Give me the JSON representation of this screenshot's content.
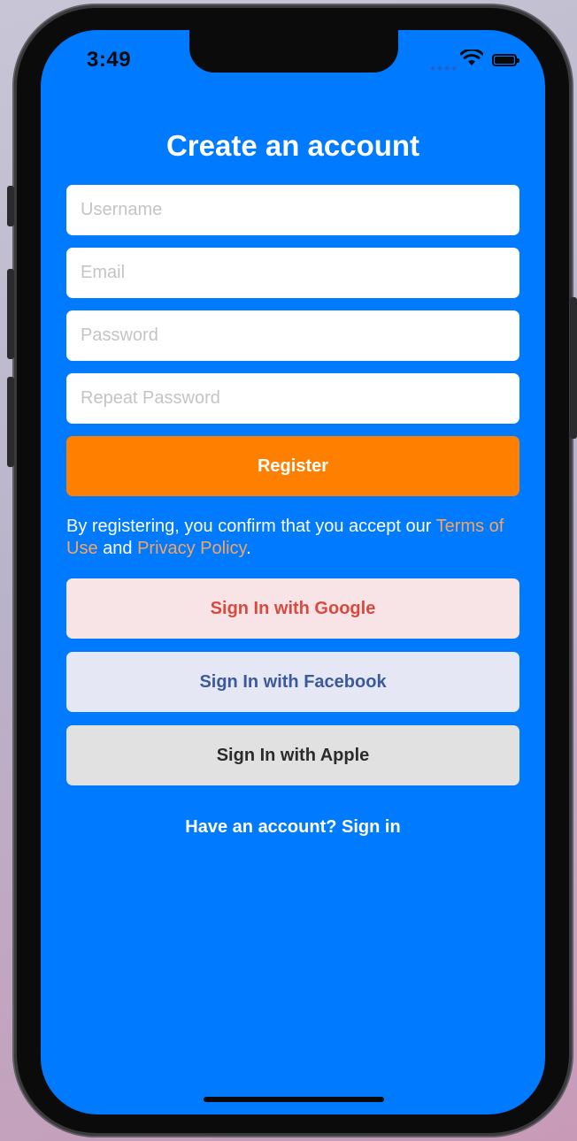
{
  "status_bar": {
    "time": "3:49"
  },
  "form": {
    "title": "Create an account",
    "username_placeholder": "Username",
    "email_placeholder": "Email",
    "password_placeholder": "Password",
    "repeat_password_placeholder": "Repeat Password",
    "register_label": "Register"
  },
  "terms": {
    "prefix": "By registering, you confirm that you accept our ",
    "terms_link": "Terms of Use",
    "middle": " and ",
    "privacy_link": "Privacy Policy",
    "suffix": "."
  },
  "social": {
    "google_label": "Sign In with Google",
    "facebook_label": "Sign In with Facebook",
    "apple_label": "Sign In with Apple"
  },
  "footer": {
    "signin_label": "Have an account? Sign in"
  },
  "colors": {
    "background": "#007aff",
    "register": "#ff8000",
    "link": "#f7a55a",
    "google_bg": "#f8e4e7",
    "google_text": "#d94a3e",
    "facebook_bg": "#e5e7f5",
    "facebook_text": "#3b5a9a",
    "apple_bg": "#e1e1e1",
    "apple_text": "#2b2b2b"
  },
  "icons": {
    "wifi": "wifi-icon",
    "battery": "battery-icon",
    "signal": "cellular-signal-icon"
  }
}
